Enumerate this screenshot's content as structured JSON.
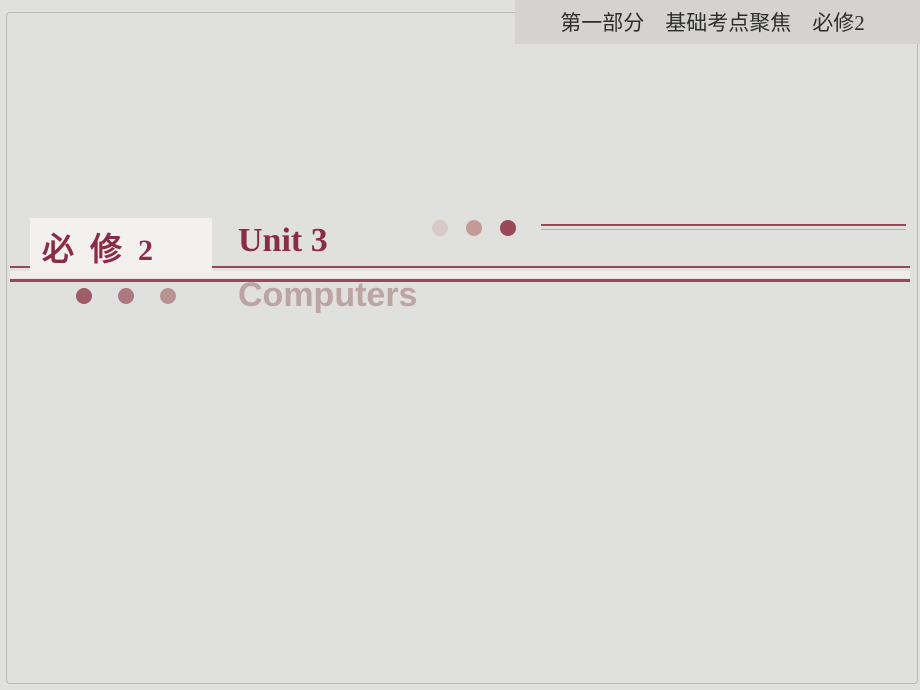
{
  "header": {
    "text": "第一部分　基础考点聚焦　必修2"
  },
  "title_band": {
    "left_label_prefix": "必 修 ",
    "left_label_num": "2",
    "unit_label": "Unit 3",
    "subtitle": "Computers"
  },
  "colors": {
    "accent": "#8b2c47",
    "muted": "#bca4a2",
    "bg": "#e0e0de"
  }
}
